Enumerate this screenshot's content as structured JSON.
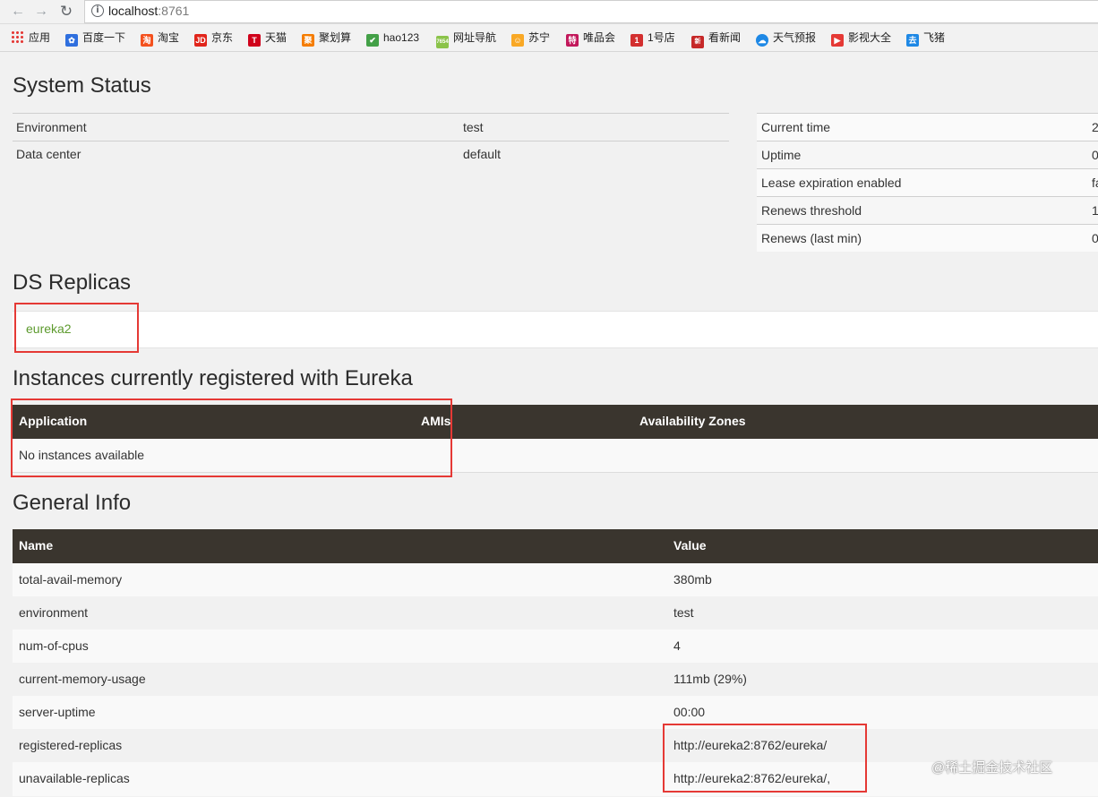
{
  "browser": {
    "url_host": "localhost",
    "url_port": ":8761",
    "bookmarks": [
      {
        "icon": "apps-grid-icon",
        "label": "应用",
        "color": "#e53935"
      },
      {
        "icon": "baidu-paw-icon",
        "label": "百度一下",
        "color": "#2f6fde"
      },
      {
        "icon": "taobao-icon",
        "label": "淘宝",
        "color": "#f4511e"
      },
      {
        "icon": "jd-icon",
        "label": "京东",
        "color": "#e1251b"
      },
      {
        "icon": "tmall-icon",
        "label": "天猫",
        "color": "#d0021b"
      },
      {
        "icon": "juhuasuan-icon",
        "label": "聚划算",
        "color": "#f57c00"
      },
      {
        "icon": "hao123-icon",
        "label": "hao123",
        "color": "#43a047"
      },
      {
        "icon": "7654-icon",
        "label": "网址导航",
        "color": "#8bc34a"
      },
      {
        "icon": "suning-icon",
        "label": "苏宁",
        "color": "#f9a825"
      },
      {
        "icon": "vip-icon",
        "label": "唯品会",
        "color": "#c2185b"
      },
      {
        "icon": "yhd-icon",
        "label": "1号店",
        "color": "#d32f2f"
      },
      {
        "icon": "news-icon",
        "label": "看新闻",
        "color": "#c62828"
      },
      {
        "icon": "weather-icon",
        "label": "天气预报",
        "color": "#1e88e5"
      },
      {
        "icon": "video-icon",
        "label": "影视大全",
        "color": "#e53935"
      },
      {
        "icon": "flypig-icon",
        "label": "飞猪",
        "color": "#1e88e5"
      }
    ]
  },
  "system_status": {
    "title": "System Status",
    "left_rows": [
      {
        "key": "Environment",
        "value": "test"
      },
      {
        "key": "Data center",
        "value": "default"
      }
    ],
    "right_rows": [
      {
        "key": "Current time",
        "value": "2"
      },
      {
        "key": "Uptime",
        "value": "0"
      },
      {
        "key": "Lease expiration enabled",
        "value": "fa"
      },
      {
        "key": "Renews threshold",
        "value": "1"
      },
      {
        "key": "Renews (last min)",
        "value": "0"
      }
    ]
  },
  "ds_replicas": {
    "title": "DS Replicas",
    "replica": "eureka2"
  },
  "instances": {
    "title": "Instances currently registered with Eureka",
    "headers": [
      "Application",
      "AMIs",
      "Availability Zones"
    ],
    "empty_text": "No instances available"
  },
  "general_info": {
    "title": "General Info",
    "headers": [
      "Name",
      "Value"
    ],
    "rows": [
      {
        "name": "total-avail-memory",
        "value": "380mb"
      },
      {
        "name": "environment",
        "value": "test"
      },
      {
        "name": "num-of-cpus",
        "value": "4"
      },
      {
        "name": "current-memory-usage",
        "value": "111mb (29%)"
      },
      {
        "name": "server-uptime",
        "value": "00:00"
      },
      {
        "name": "registered-replicas",
        "value": "http://eureka2:8762/eureka/"
      },
      {
        "name": "unavailable-replicas",
        "value": "http://eureka2:8762/eureka/,"
      }
    ]
  },
  "watermark": "@稀土掘金技术社区",
  "highlight_color": "#e53935"
}
